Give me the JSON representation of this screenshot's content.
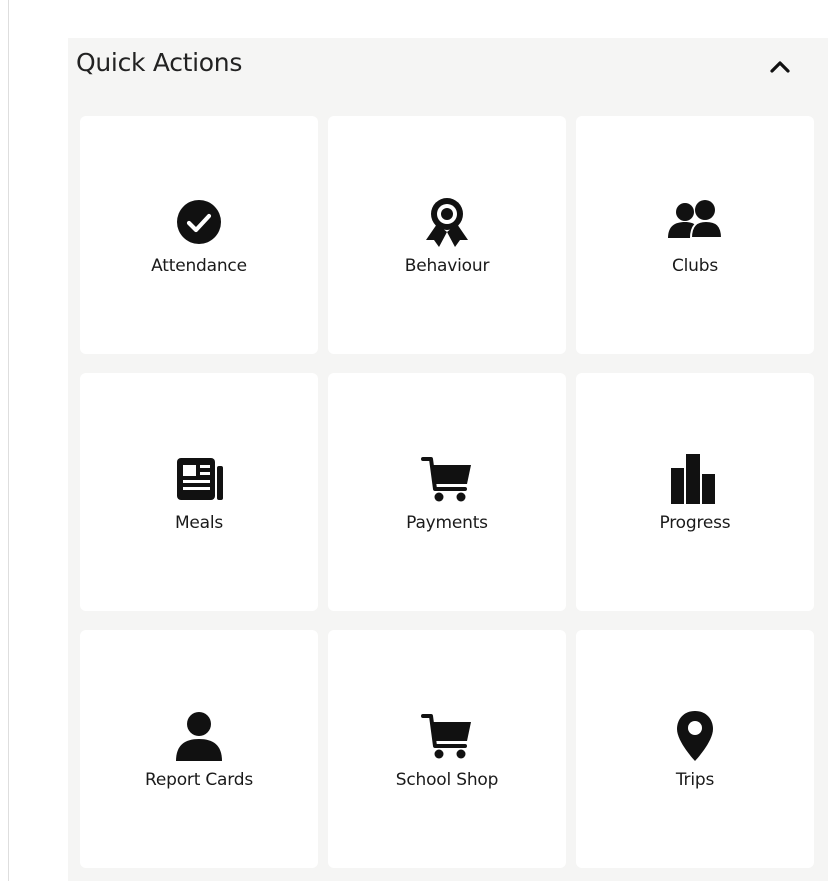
{
  "quick_actions": {
    "title": "Quick Actions",
    "toggle_icon": "chevron-up-icon",
    "tiles": [
      {
        "label": "Attendance",
        "icon": "check-circle-icon"
      },
      {
        "label": "Behaviour",
        "icon": "award-ribbon-icon"
      },
      {
        "label": "Clubs",
        "icon": "users-group-icon"
      },
      {
        "label": "Meals",
        "icon": "newspaper-icon"
      },
      {
        "label": "Payments",
        "icon": "shopping-cart-icon"
      },
      {
        "label": "Progress",
        "icon": "bar-chart-icon"
      },
      {
        "label": "Report Cards",
        "icon": "user-icon"
      },
      {
        "label": "School Shop",
        "icon": "shopping-cart-icon"
      },
      {
        "label": "Trips",
        "icon": "map-pin-icon"
      }
    ]
  },
  "colors": {
    "panel_background": "#f5f5f4",
    "tile_background": "#ffffff",
    "icon_color": "#111111",
    "text_color": "#1a1a1a"
  }
}
